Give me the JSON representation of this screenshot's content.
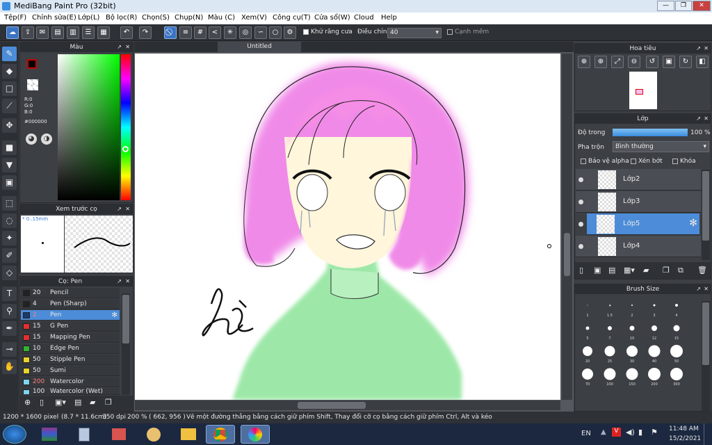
{
  "window": {
    "title": "MediBang Paint Pro (32bit)",
    "min": "—",
    "max": "❐",
    "close": "✕"
  },
  "menu": [
    "Tệp(F)",
    "Chỉnh sửa(E)",
    "Lớp(L)",
    "Bộ lọc(R)",
    "Chọn(S)",
    "Chụp(N)",
    "Màu (C)",
    "Xem(V)",
    "Công cụ(T)",
    "Cửa sổ(W)",
    "Cloud",
    "Help"
  ],
  "toolbar": {
    "antialias_label": "Khử răng cưa",
    "correction_label": "Điều chỉnh",
    "correction_value": "40",
    "soft_edge_label": "Cạnh mềm"
  },
  "color_panel": {
    "title": "Màu",
    "r": "R:0",
    "g": "G:0",
    "b": "B:0",
    "hex": "#000000"
  },
  "preview_panel": {
    "title": "Xem trước cọ",
    "size": "* 0..15mm"
  },
  "brush_panel": {
    "title": "Cọ: Pen",
    "items": [
      {
        "size": "20",
        "name": "Pencil",
        "color": "#222222"
      },
      {
        "size": "4",
        "name": "Pen (Sharp)",
        "color": "#222222"
      },
      {
        "size": "2",
        "name": "Pen",
        "color": "#1a3a6e"
      },
      {
        "size": "15",
        "name": "G Pen",
        "color": "#e03030"
      },
      {
        "size": "15",
        "name": "Mapping Pen",
        "color": "#e03030"
      },
      {
        "size": "10",
        "name": "Edge Pen",
        "color": "#2fb52f"
      },
      {
        "size": "50",
        "name": "Stipple Pen",
        "color": "#e8d42a"
      },
      {
        "size": "50",
        "name": "Sumi",
        "color": "#e8d42a"
      },
      {
        "size": "200",
        "name": "Watercolor",
        "color": "#7fd4f0"
      },
      {
        "size": "100",
        "name": "Watercolor (Wet)",
        "color": "#7fd4f0"
      }
    ]
  },
  "document": {
    "tab": "Untitled",
    "signature": "Hà"
  },
  "navigator": {
    "title": "Hoa tiêu"
  },
  "layers": {
    "title": "Lớp",
    "opacity_label": "Độ trong",
    "opacity_value": "100 %",
    "opacity": 1.0,
    "blend_label": "Pha trộn",
    "blend_value": "Bình thường",
    "protect_alpha": "Bảo vệ alpha",
    "clip": "Xén bớt",
    "lock": "Khóa",
    "items": [
      "Lớp2",
      "Lớp3",
      "Lớp5",
      "Lớp4"
    ]
  },
  "brush_size": {
    "title": "Brush Size",
    "sizes": [
      "1",
      "1.5",
      "2",
      "3",
      "4",
      "5",
      "7",
      "10",
      "12",
      "15",
      "20",
      "25",
      "30",
      "40",
      "50",
      "70",
      "100",
      "150",
      "200",
      "300"
    ]
  },
  "status": {
    "size": "1200 * 1600 pixel",
    "cm": "(8.7 * 11.6cm)",
    "dpi": "350 dpi",
    "zoom": "200 %",
    "coords": "( 662, 956 )",
    "hint": "Vẽ một đường thẳng bằng cách giữ phím Shift, Thay đổi cỡ cọ bằng cách giữ phím Ctrl, Alt và kéo"
  },
  "taskbar": {
    "lang": "EN",
    "time": "11:48 AM",
    "date": "15/2/2021"
  }
}
